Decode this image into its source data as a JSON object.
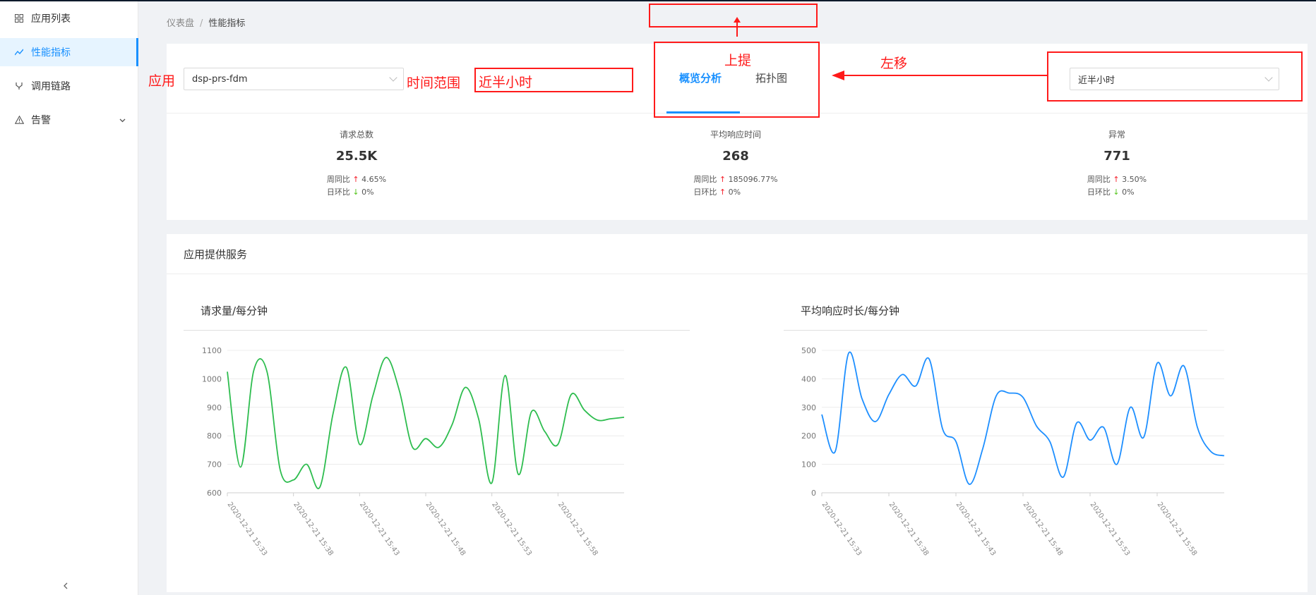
{
  "sidebar": {
    "items": [
      {
        "label": "应用列表",
        "icon": "grid-icon",
        "active": false
      },
      {
        "label": "性能指标",
        "icon": "line-chart-icon",
        "active": true
      },
      {
        "label": "调用链路",
        "icon": "branch-icon",
        "active": false
      },
      {
        "label": "告警",
        "icon": "warning-icon",
        "active": false
      }
    ]
  },
  "breadcrumb": {
    "root": "仪表盘",
    "current": "性能指标"
  },
  "filters": {
    "app_value": "dsp-prs-fdm",
    "time_range_value": "近半小时"
  },
  "tabs": [
    {
      "label": "概览分析",
      "active": true
    },
    {
      "label": "拓扑图",
      "active": false
    }
  ],
  "stats": [
    {
      "label": "请求总数",
      "value": "25.5K",
      "week_label": "周同比",
      "week_value": "4.65%",
      "week_trend": "up",
      "day_label": "日环比",
      "day_value": "0%",
      "day_trend": "down"
    },
    {
      "label": "平均响应时间",
      "value": "268",
      "week_label": "周同比",
      "week_value": "185096.77%",
      "week_trend": "up",
      "day_label": "日环比",
      "day_value": "0%",
      "day_trend": "up"
    },
    {
      "label": "异常",
      "value": "771",
      "week_label": "周同比",
      "week_value": "3.50%",
      "week_trend": "up",
      "day_label": "日环比",
      "day_value": "0%",
      "day_trend": "down"
    }
  ],
  "section": {
    "title": "应用提供服务"
  },
  "annotations": {
    "app_label": "应用",
    "time_label": "时间范围",
    "time_box": "近半小时",
    "up_label": "上提",
    "left_label": "左移"
  },
  "colors": {
    "accent": "#1890ff",
    "green_series": "#2ebd4f",
    "blue_series": "#1e8fff",
    "annotation": "#ff1a1a"
  },
  "chart_data": [
    {
      "type": "line",
      "title": "请求量/每分钟",
      "x": [
        "2020-12-21 15:33",
        "",
        "",
        "",
        "",
        "2020-12-21 15:38",
        "",
        "",
        "",
        "",
        "2020-12-21 15:43",
        "",
        "",
        "",
        "",
        "2020-12-21 15:48",
        "",
        "",
        "",
        "",
        "2020-12-21 15:53",
        "",
        "",
        "",
        "",
        "2020-12-21 15:58",
        "",
        "",
        "",
        "",
        ""
      ],
      "x_ticks": [
        "2020-12-21 15:33",
        "2020-12-21 15:38",
        "2020-12-21 15:43",
        "2020-12-21 15:48",
        "2020-12-21 15:53",
        "2020-12-21 15:58"
      ],
      "series": [
        {
          "color": "#2ebd4f",
          "values": [
            1025,
            690,
            1030,
            1025,
            680,
            645,
            700,
            620,
            880,
            1040,
            770,
            940,
            1075,
            960,
            760,
            790,
            760,
            840,
            970,
            860,
            635,
            1012,
            665,
            885,
            815,
            770,
            945,
            890,
            855,
            860,
            865
          ]
        }
      ],
      "ylim": [
        600,
        1100
      ],
      "yticks": [
        600,
        700,
        800,
        900,
        1000,
        1100
      ],
      "grid": true
    },
    {
      "type": "line",
      "title": "平均响应时长/每分钟",
      "x": [
        "2020-12-21 15:33",
        "",
        "",
        "",
        "",
        "2020-12-21 15:38",
        "",
        "",
        "",
        "",
        "2020-12-21 15:43",
        "",
        "",
        "",
        "",
        "2020-12-21 15:48",
        "",
        "",
        "",
        "",
        "2020-12-21 15:53",
        "",
        "",
        "",
        "",
        "2020-12-21 15:58",
        "",
        "",
        "",
        "",
        ""
      ],
      "x_ticks": [
        "2020-12-21 15:33",
        "2020-12-21 15:38",
        "2020-12-21 15:43",
        "2020-12-21 15:48",
        "2020-12-21 15:53",
        "2020-12-21 15:58"
      ],
      "series": [
        {
          "color": "#1e8fff",
          "values": [
            275,
            145,
            490,
            330,
            250,
            345,
            415,
            375,
            470,
            225,
            180,
            30,
            155,
            340,
            350,
            335,
            235,
            180,
            55,
            245,
            185,
            230,
            100,
            300,
            195,
            455,
            340,
            445,
            230,
            145,
            130
          ]
        }
      ],
      "ylim": [
        0,
        500
      ],
      "yticks": [
        0,
        100,
        200,
        300,
        400,
        500
      ],
      "grid": true
    }
  ]
}
